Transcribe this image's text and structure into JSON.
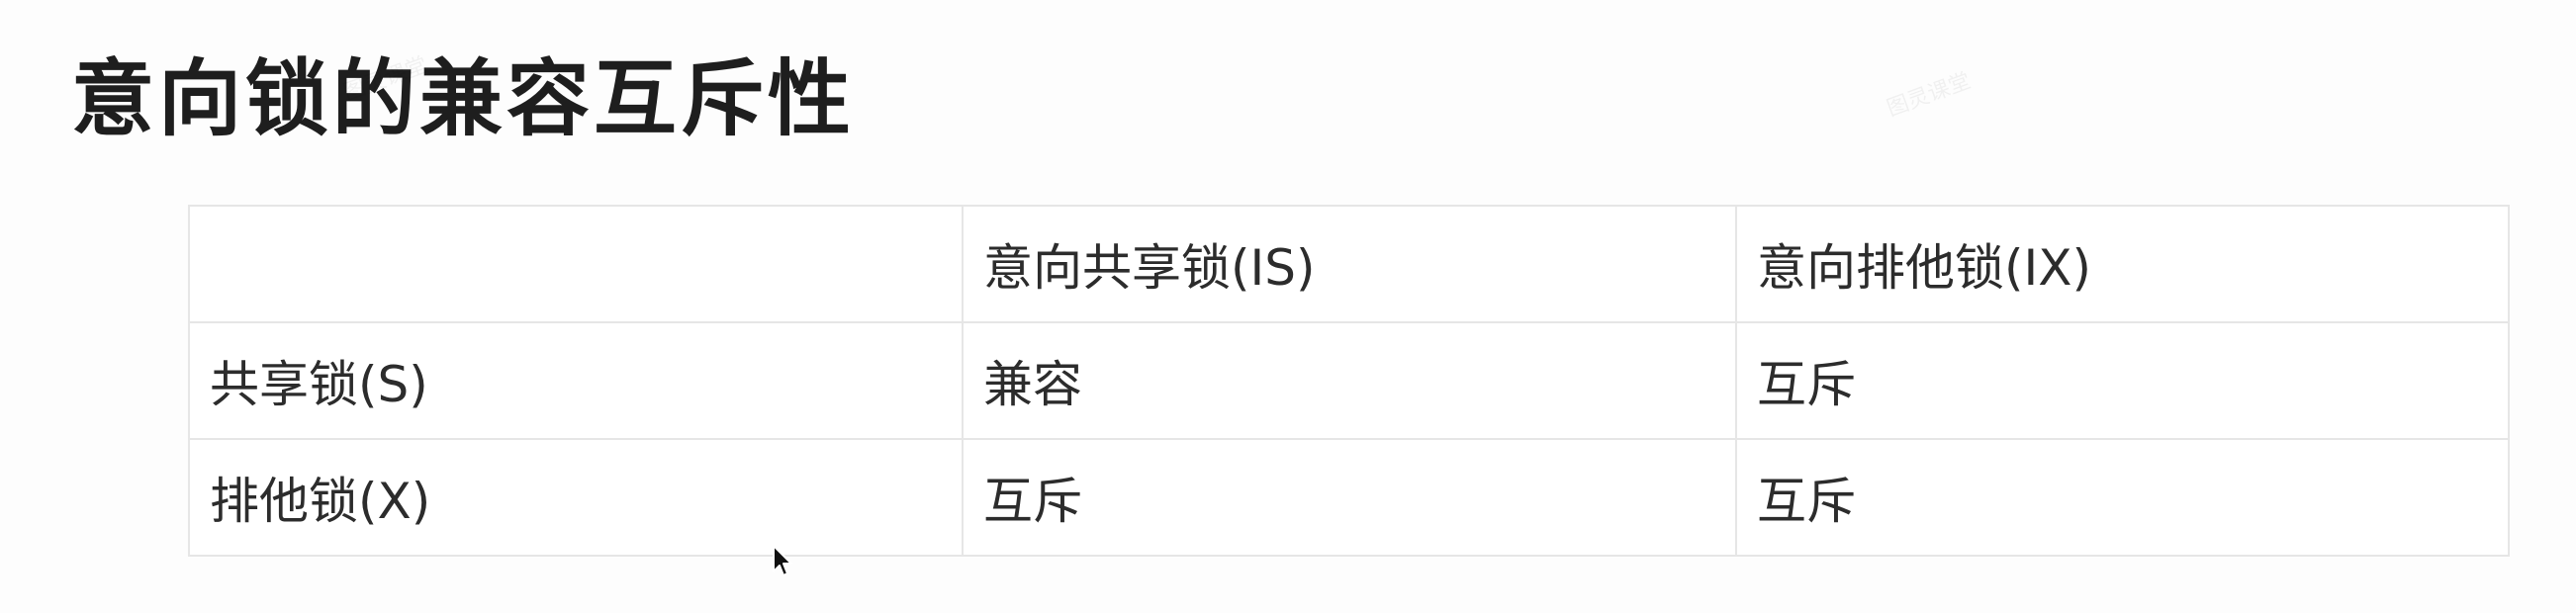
{
  "title": "意向锁的兼容互斥性",
  "table": {
    "header": [
      "",
      "意向共享锁(IS)",
      "意向排他锁(IX)"
    ],
    "rows": [
      [
        "共享锁(S)",
        "兼容",
        "互斥"
      ],
      [
        "排他锁(X)",
        "互斥",
        "互斥"
      ]
    ]
  },
  "watermark_text": "图灵课堂",
  "colors": {
    "background": "#fdfdfd",
    "border": "#e6e6e6",
    "text": "#2c2c2c",
    "title": "#1e1e1e"
  },
  "icons": [
    "mouse-pointer-icon"
  ]
}
